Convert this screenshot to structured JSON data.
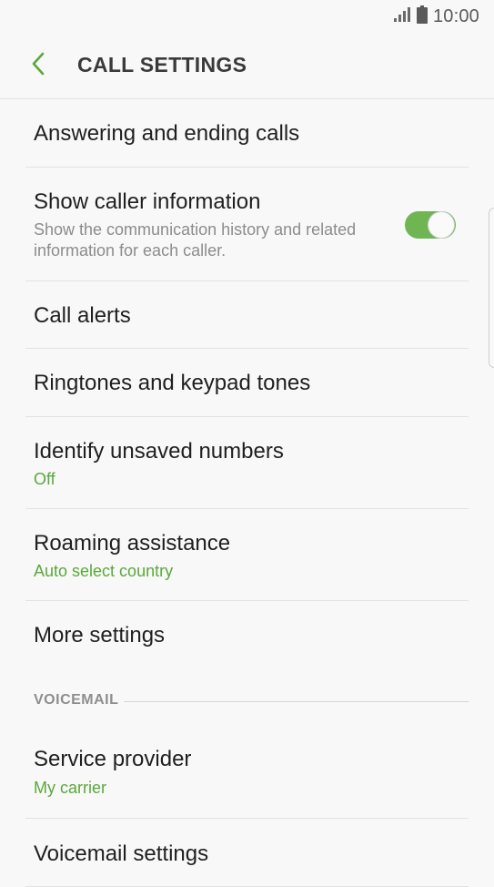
{
  "status_bar": {
    "time": "10:00",
    "signal_icon": "signal-icon",
    "battery_icon": "battery-icon"
  },
  "app_bar": {
    "back_icon": "chevron-left-icon",
    "title": "CALL SETTINGS"
  },
  "colors": {
    "accent": "#5aa83a",
    "toggle_on": "#6fb552",
    "background": "#f8f8f8",
    "divider": "#e2e2e2"
  },
  "settings": {
    "answering": {
      "title": "Answering and ending calls"
    },
    "caller_info": {
      "title": "Show caller information",
      "description_line1": "Show the communication history and related",
      "description_line2": "information for each caller.",
      "enabled": true
    },
    "call_alerts": {
      "title": "Call alerts"
    },
    "ringtones": {
      "title": "Ringtones and keypad tones"
    },
    "identify": {
      "title": "Identify unsaved numbers",
      "value": "Off"
    },
    "roaming": {
      "title": "Roaming assistance",
      "value": "Auto select country"
    },
    "more": {
      "title": "More settings"
    }
  },
  "voicemail": {
    "section_label": "VOICEMAIL",
    "provider": {
      "title": "Service provider",
      "value": "My carrier"
    },
    "settings": {
      "title": "Voicemail settings"
    }
  }
}
